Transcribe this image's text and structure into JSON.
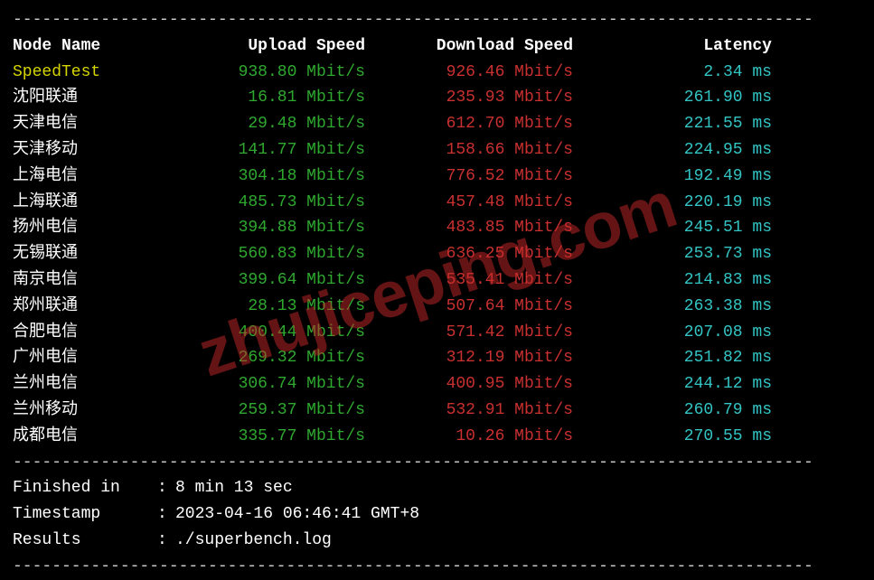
{
  "divider": "----------------------------------------------------------------------------------",
  "headers": {
    "name": "Node Name",
    "upload": "Upload Speed",
    "download": "Download Speed",
    "latency": "Latency"
  },
  "speedtest": {
    "name": "SpeedTest",
    "upload": "938.80 Mbit/s",
    "download": "926.46 Mbit/s",
    "latency": "2.34 ms"
  },
  "rows": [
    {
      "name": "沈阳联通",
      "upload": "16.81 Mbit/s",
      "download": "235.93 Mbit/s",
      "latency": "261.90 ms"
    },
    {
      "name": "天津电信",
      "upload": "29.48 Mbit/s",
      "download": "612.70 Mbit/s",
      "latency": "221.55 ms"
    },
    {
      "name": "天津移动",
      "upload": "141.77 Mbit/s",
      "download": "158.66 Mbit/s",
      "latency": "224.95 ms"
    },
    {
      "name": "上海电信",
      "upload": "304.18 Mbit/s",
      "download": "776.52 Mbit/s",
      "latency": "192.49 ms"
    },
    {
      "name": "上海联通",
      "upload": "485.73 Mbit/s",
      "download": "457.48 Mbit/s",
      "latency": "220.19 ms"
    },
    {
      "name": "扬州电信",
      "upload": "394.88 Mbit/s",
      "download": "483.85 Mbit/s",
      "latency": "245.51 ms"
    },
    {
      "name": "无锡联通",
      "upload": "560.83 Mbit/s",
      "download": "636.25 Mbit/s",
      "latency": "253.73 ms"
    },
    {
      "name": "南京电信",
      "upload": "399.64 Mbit/s",
      "download": "535.41 Mbit/s",
      "latency": "214.83 ms"
    },
    {
      "name": "郑州联通",
      "upload": "28.13 Mbit/s",
      "download": "507.64 Mbit/s",
      "latency": "263.38 ms"
    },
    {
      "name": "合肥电信",
      "upload": "400.44 Mbit/s",
      "download": "571.42 Mbit/s",
      "latency": "207.08 ms"
    },
    {
      "name": "广州电信",
      "upload": "269.32 Mbit/s",
      "download": "312.19 Mbit/s",
      "latency": "251.82 ms"
    },
    {
      "name": "兰州电信",
      "upload": "306.74 Mbit/s",
      "download": "400.95 Mbit/s",
      "latency": "244.12 ms"
    },
    {
      "name": "兰州移动",
      "upload": "259.37 Mbit/s",
      "download": "532.91 Mbit/s",
      "latency": "260.79 ms"
    },
    {
      "name": "成都电信",
      "upload": "335.77 Mbit/s",
      "download": "10.26 Mbit/s",
      "latency": "270.55 ms"
    }
  ],
  "footer": {
    "finished_label": "Finished in",
    "finished_value": "8 min 13 sec",
    "timestamp_label": "Timestamp",
    "timestamp_value": "2023-04-16 06:46:41 GMT+8",
    "results_label": "Results",
    "results_value": "./superbench.log"
  },
  "watermark": "zhujiceping.com"
}
